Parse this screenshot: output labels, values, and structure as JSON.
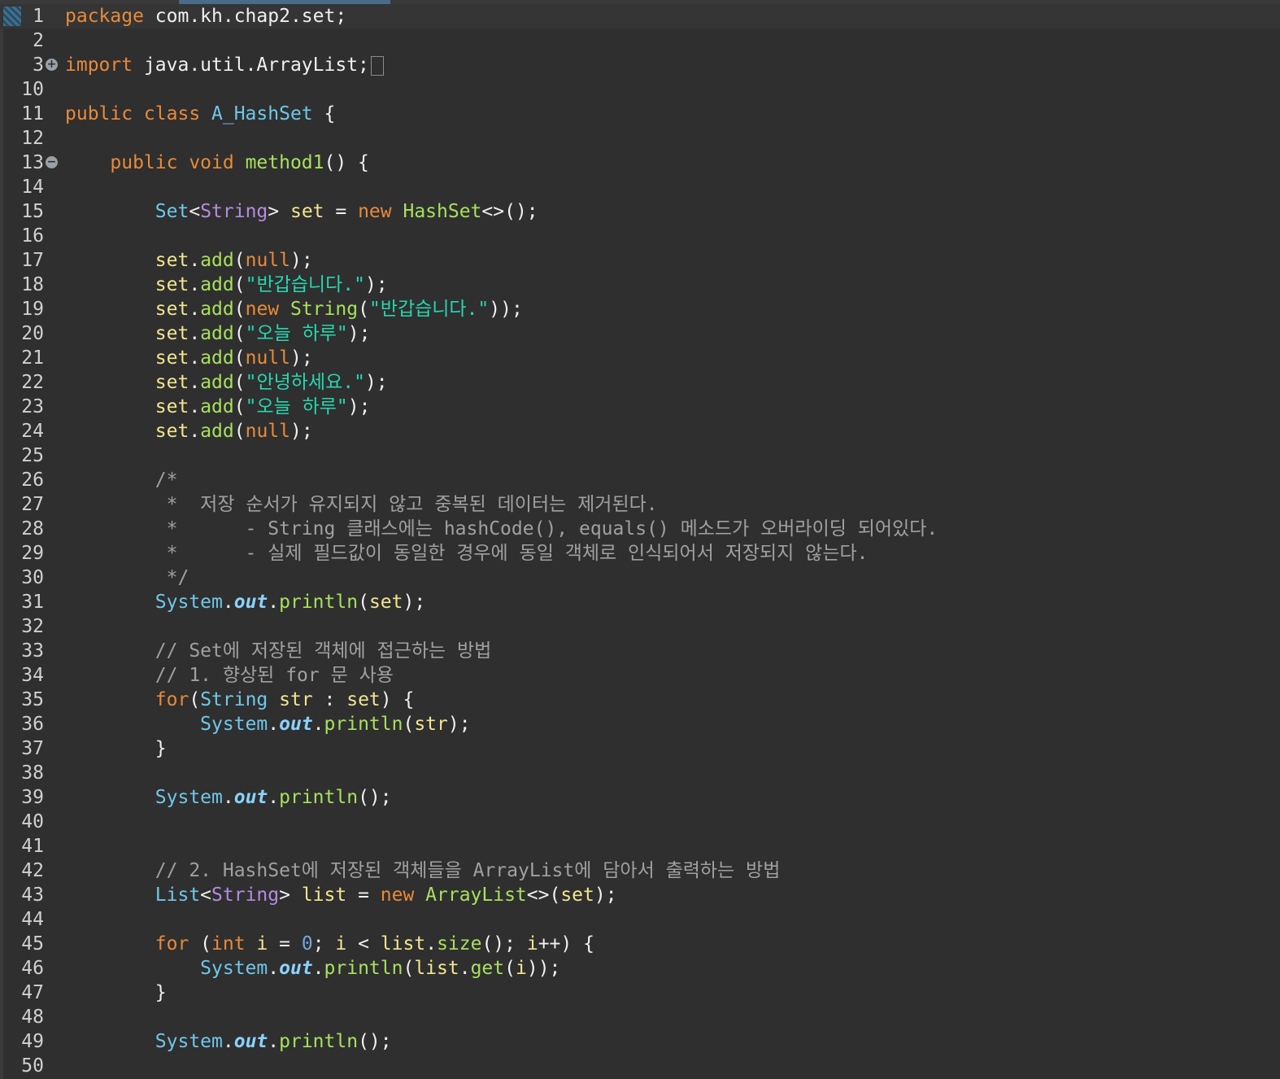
{
  "editor": {
    "lines": [
      {
        "n": "1",
        "tokens": [
          [
            "kw",
            "package"
          ],
          [
            "pun",
            " com.kh.chap2.set;"
          ]
        ],
        "current": true,
        "bookmark": true
      },
      {
        "n": "2",
        "tokens": []
      },
      {
        "n": "3",
        "marker": "+",
        "tokens": [
          [
            "kw",
            "import"
          ],
          [
            "pun",
            " java.util.ArrayList;"
          ]
        ],
        "fold": true
      },
      {
        "n": "10",
        "tokens": []
      },
      {
        "n": "11",
        "tokens": [
          [
            "kw",
            "public class "
          ],
          [
            "cls",
            "A_HashSet"
          ],
          [
            "pun",
            " {"
          ]
        ]
      },
      {
        "n": "12",
        "tokens": []
      },
      {
        "n": "13",
        "marker": "−",
        "tokens": [
          [
            "pun",
            "    "
          ],
          [
            "kw",
            "public void "
          ],
          [
            "mth",
            "method1"
          ],
          [
            "pun",
            "() {"
          ]
        ]
      },
      {
        "n": "14",
        "tokens": []
      },
      {
        "n": "15",
        "tokens": [
          [
            "pun",
            "        "
          ],
          [
            "cls",
            "Set"
          ],
          [
            "pun",
            "<"
          ],
          [
            "typ",
            "String"
          ],
          [
            "pun",
            "> "
          ],
          [
            "var",
            "set"
          ],
          [
            "pun",
            " = "
          ],
          [
            "kw",
            "new "
          ],
          [
            "mth",
            "HashSet"
          ],
          [
            "pun",
            "<>();"
          ]
        ]
      },
      {
        "n": "16",
        "tokens": []
      },
      {
        "n": "17",
        "tokens": [
          [
            "pun",
            "        "
          ],
          [
            "var",
            "set"
          ],
          [
            "pun",
            "."
          ],
          [
            "mth",
            "add"
          ],
          [
            "pun",
            "("
          ],
          [
            "kw",
            "null"
          ],
          [
            "pun",
            ");"
          ]
        ]
      },
      {
        "n": "18",
        "tokens": [
          [
            "pun",
            "        "
          ],
          [
            "var",
            "set"
          ],
          [
            "pun",
            "."
          ],
          [
            "mth",
            "add"
          ],
          [
            "pun",
            "("
          ],
          [
            "str",
            "\"반갑습니다.\""
          ],
          [
            "pun",
            ");"
          ]
        ]
      },
      {
        "n": "19",
        "tokens": [
          [
            "pun",
            "        "
          ],
          [
            "var",
            "set"
          ],
          [
            "pun",
            "."
          ],
          [
            "mth",
            "add"
          ],
          [
            "pun",
            "("
          ],
          [
            "kw",
            "new "
          ],
          [
            "mth",
            "String"
          ],
          [
            "pun",
            "("
          ],
          [
            "str",
            "\"반갑습니다.\""
          ],
          [
            "pun",
            "));"
          ]
        ]
      },
      {
        "n": "20",
        "tokens": [
          [
            "pun",
            "        "
          ],
          [
            "var",
            "set"
          ],
          [
            "pun",
            "."
          ],
          [
            "mth",
            "add"
          ],
          [
            "pun",
            "("
          ],
          [
            "str",
            "\"오늘 하루\""
          ],
          [
            "pun",
            ");"
          ]
        ]
      },
      {
        "n": "21",
        "tokens": [
          [
            "pun",
            "        "
          ],
          [
            "var",
            "set"
          ],
          [
            "pun",
            "."
          ],
          [
            "mth",
            "add"
          ],
          [
            "pun",
            "("
          ],
          [
            "kw",
            "null"
          ],
          [
            "pun",
            ");"
          ]
        ]
      },
      {
        "n": "22",
        "tokens": [
          [
            "pun",
            "        "
          ],
          [
            "var",
            "set"
          ],
          [
            "pun",
            "."
          ],
          [
            "mth",
            "add"
          ],
          [
            "pun",
            "("
          ],
          [
            "str",
            "\"안녕하세요.\""
          ],
          [
            "pun",
            ");"
          ]
        ]
      },
      {
        "n": "23",
        "tokens": [
          [
            "pun",
            "        "
          ],
          [
            "var",
            "set"
          ],
          [
            "pun",
            "."
          ],
          [
            "mth",
            "add"
          ],
          [
            "pun",
            "("
          ],
          [
            "str",
            "\"오늘 하루\""
          ],
          [
            "pun",
            ");"
          ]
        ]
      },
      {
        "n": "24",
        "tokens": [
          [
            "pun",
            "        "
          ],
          [
            "var",
            "set"
          ],
          [
            "pun",
            "."
          ],
          [
            "mth",
            "add"
          ],
          [
            "pun",
            "("
          ],
          [
            "kw",
            "null"
          ],
          [
            "pun",
            ");"
          ]
        ]
      },
      {
        "n": "25",
        "tokens": []
      },
      {
        "n": "26",
        "tokens": [
          [
            "cmt",
            "        /*"
          ]
        ]
      },
      {
        "n": "27",
        "tokens": [
          [
            "cmt",
            "         *  저장 순서가 유지되지 않고 중복된 데이터는 제거된다."
          ]
        ]
      },
      {
        "n": "28",
        "tokens": [
          [
            "cmt",
            "         *      - String 클래스에는 hashCode(), equals() 메소드가 오버라이딩 되어있다."
          ]
        ]
      },
      {
        "n": "29",
        "tokens": [
          [
            "cmt",
            "         *      - 실제 필드값이 동일한 경우에 동일 객체로 인식되어서 저장되지 않는다."
          ]
        ]
      },
      {
        "n": "30",
        "tokens": [
          [
            "cmt",
            "         */"
          ]
        ]
      },
      {
        "n": "31",
        "tokens": [
          [
            "pun",
            "        "
          ],
          [
            "cls",
            "System"
          ],
          [
            "pun",
            "."
          ],
          [
            "fld",
            "out"
          ],
          [
            "pun",
            "."
          ],
          [
            "mth",
            "println"
          ],
          [
            "pun",
            "("
          ],
          [
            "var",
            "set"
          ],
          [
            "pun",
            ");"
          ]
        ]
      },
      {
        "n": "32",
        "tokens": []
      },
      {
        "n": "33",
        "tokens": [
          [
            "cmt",
            "        // Set에 저장된 객체에 접근하는 방법"
          ]
        ]
      },
      {
        "n": "34",
        "tokens": [
          [
            "cmt",
            "        // 1. 향상된 for 문 사용"
          ]
        ]
      },
      {
        "n": "35",
        "tokens": [
          [
            "pun",
            "        "
          ],
          [
            "kw",
            "for"
          ],
          [
            "pun",
            "("
          ],
          [
            "cls",
            "String"
          ],
          [
            "pun",
            " "
          ],
          [
            "var",
            "str"
          ],
          [
            "pun",
            " : "
          ],
          [
            "var",
            "set"
          ],
          [
            "pun",
            ") {"
          ]
        ]
      },
      {
        "n": "36",
        "tokens": [
          [
            "pun",
            "            "
          ],
          [
            "cls",
            "System"
          ],
          [
            "pun",
            "."
          ],
          [
            "fld",
            "out"
          ],
          [
            "pun",
            "."
          ],
          [
            "mth",
            "println"
          ],
          [
            "pun",
            "("
          ],
          [
            "var",
            "str"
          ],
          [
            "pun",
            ");"
          ]
        ]
      },
      {
        "n": "37",
        "tokens": [
          [
            "pun",
            "        }"
          ]
        ]
      },
      {
        "n": "38",
        "tokens": []
      },
      {
        "n": "39",
        "tokens": [
          [
            "pun",
            "        "
          ],
          [
            "cls",
            "System"
          ],
          [
            "pun",
            "."
          ],
          [
            "fld",
            "out"
          ],
          [
            "pun",
            "."
          ],
          [
            "mth",
            "println"
          ],
          [
            "pun",
            "();"
          ]
        ]
      },
      {
        "n": "40",
        "tokens": []
      },
      {
        "n": "41",
        "tokens": []
      },
      {
        "n": "42",
        "tokens": [
          [
            "cmt",
            "        // 2. HashSet에 저장된 객체들을 ArrayList에 담아서 출력하는 방법"
          ]
        ]
      },
      {
        "n": "43",
        "tokens": [
          [
            "pun",
            "        "
          ],
          [
            "cls",
            "List"
          ],
          [
            "pun",
            "<"
          ],
          [
            "typ",
            "String"
          ],
          [
            "pun",
            "> "
          ],
          [
            "var",
            "list"
          ],
          [
            "pun",
            " = "
          ],
          [
            "kw",
            "new "
          ],
          [
            "mth",
            "ArrayList"
          ],
          [
            "pun",
            "<>("
          ],
          [
            "var",
            "set"
          ],
          [
            "pun",
            ");"
          ]
        ]
      },
      {
        "n": "44",
        "tokens": []
      },
      {
        "n": "45",
        "tokens": [
          [
            "pun",
            "        "
          ],
          [
            "kw",
            "for"
          ],
          [
            "pun",
            " ("
          ],
          [
            "kw",
            "int"
          ],
          [
            "pun",
            " "
          ],
          [
            "var",
            "i"
          ],
          [
            "pun",
            " = "
          ],
          [
            "num",
            "0"
          ],
          [
            "pun",
            "; "
          ],
          [
            "var",
            "i"
          ],
          [
            "pun",
            " < "
          ],
          [
            "var",
            "list"
          ],
          [
            "pun",
            "."
          ],
          [
            "mth",
            "size"
          ],
          [
            "pun",
            "(); "
          ],
          [
            "var",
            "i"
          ],
          [
            "pun",
            "++) {"
          ]
        ]
      },
      {
        "n": "46",
        "tokens": [
          [
            "pun",
            "            "
          ],
          [
            "cls",
            "System"
          ],
          [
            "pun",
            "."
          ],
          [
            "fld",
            "out"
          ],
          [
            "pun",
            "."
          ],
          [
            "mth",
            "println"
          ],
          [
            "pun",
            "("
          ],
          [
            "var",
            "list"
          ],
          [
            "pun",
            "."
          ],
          [
            "mth",
            "get"
          ],
          [
            "pun",
            "("
          ],
          [
            "var",
            "i"
          ],
          [
            "pun",
            "));"
          ]
        ]
      },
      {
        "n": "47",
        "tokens": [
          [
            "pun",
            "        }"
          ]
        ]
      },
      {
        "n": "48",
        "tokens": []
      },
      {
        "n": "49",
        "tokens": [
          [
            "pun",
            "        "
          ],
          [
            "cls",
            "System"
          ],
          [
            "pun",
            "."
          ],
          [
            "fld",
            "out"
          ],
          [
            "pun",
            "."
          ],
          [
            "mth",
            "println"
          ],
          [
            "pun",
            "();"
          ]
        ]
      },
      {
        "n": "50",
        "tokens": []
      }
    ]
  }
}
